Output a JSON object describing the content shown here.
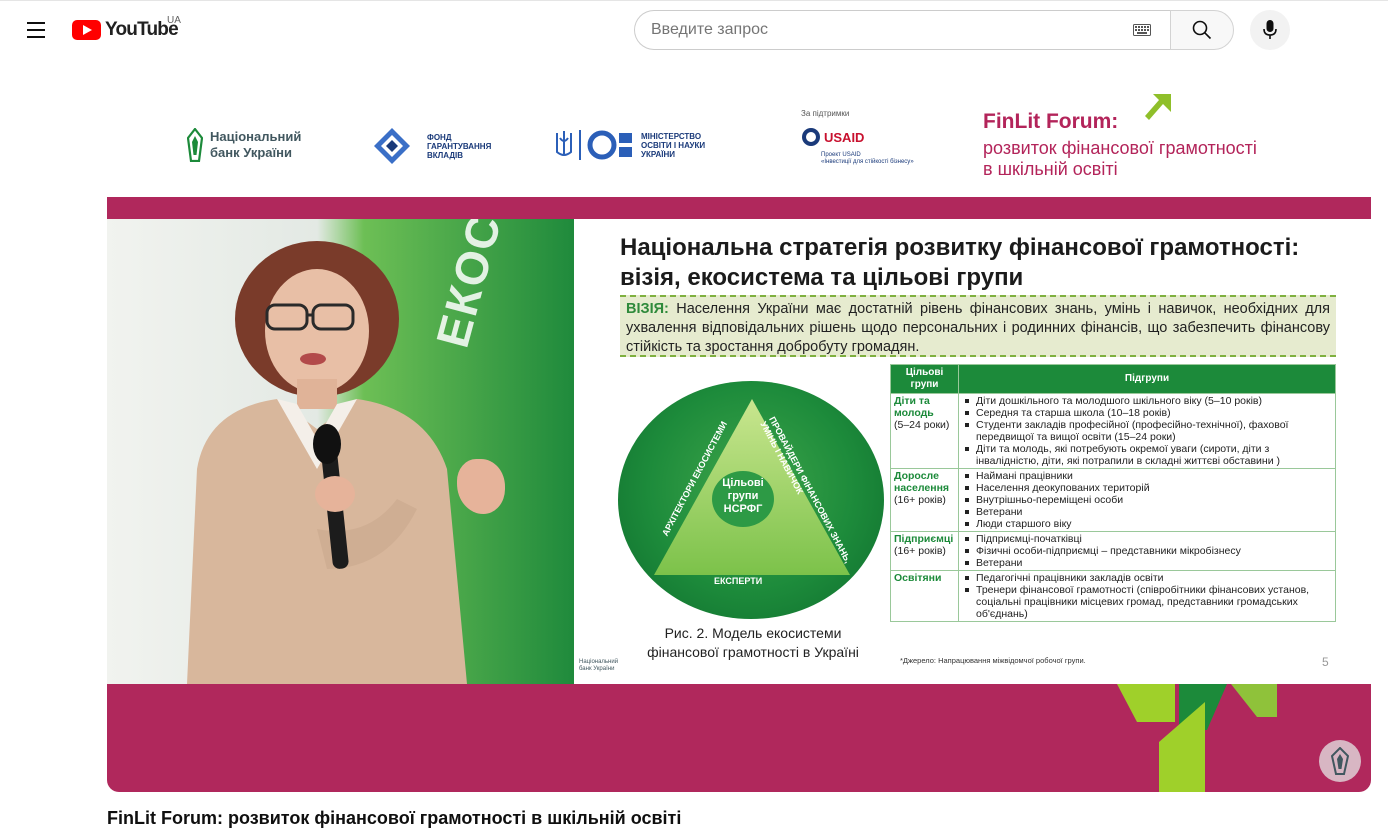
{
  "masthead": {
    "logo_text": "YouTube",
    "country_code": "UA",
    "search_placeholder": "Введите запрос"
  },
  "video": {
    "title": "FinLit Forum: розвиток фінансової грамотності в шкільній освіті"
  },
  "banner": {
    "nbu": "Національний\nбанк України",
    "fund": "ФОНД\nГАРАНТУВАННЯ\nВКЛАДІВ",
    "ministry": "МІНІСТЕРСТВО\nОСВІТИ І НАУКИ\nУКРАЇНИ",
    "support_label": "За підтримки",
    "usaid": "USAID",
    "usaid_project": "Проект USAID\n«Інвестиції для стійкості бізнесу»",
    "finlit_title": "FinLit Forum:",
    "finlit_subtitle": "розвиток фінансової грамотності\nв шкільній освіті"
  },
  "backdrop_text": "ЕКОСИСТЕМ",
  "slide": {
    "title": "Національна стратегія розвитку фінансової грамотності: візія, екосистема та цільові групи",
    "vision_label": "ВІЗІЯ:",
    "vision_text": "Населення України має достатній рівень фінансових знань, умінь і навичок, необхідних для ухвалення відповідальних рішень щодо персональних і родинних фінансів, що забезпечить фінансову стійкість та зростання добробуту громадян.",
    "diagram": {
      "center": "Цільові\nгрупи\nНСРФГ",
      "left": "АРХІТЕКТОРИ  ЕКОСИСТЕМИ",
      "right": "ПРОВАЙДЕРИ ФІНАНСОВИХ ЗНАНЬ,\nУМІНЬ І НАВИЧОК",
      "bottom": "ЕКСПЕРТИ"
    },
    "caption": "Рис. 2. Модель екосистеми\nфінансової грамотності в Україні",
    "logo": "Національний\nбанк України",
    "table": {
      "headers": [
        "Цільові групи",
        "Підгрупи"
      ],
      "rows": [
        {
          "group": "Діти та молодь",
          "age": "(5–24 роки)",
          "items": [
            "Діти дошкільного та молодшого шкільного віку (5–10 років)",
            "Середня та старша школа (10–18 років)",
            "Студенти закладів професійної (професійно-технічної), фахової передвищої та вищої освіти (15–24 роки)",
            "Діти та молодь, які потребують окремої уваги (сироти, діти з інвалідністю, діти, які потрапили в складні життєві обставини )"
          ]
        },
        {
          "group": "Доросле населення",
          "age": "(16+ років)",
          "items": [
            "Наймані працівники",
            "Населення деокупованих територій",
            "Внутрішньо-переміщені особи",
            "Ветерани",
            "Люди старшого віку"
          ]
        },
        {
          "group": "Підприємці",
          "age": "(16+ років)",
          "items": [
            "Підприємці-початківці",
            "Фізичні особи-підприємці – представники мікробізнесу",
            "Ветерани"
          ]
        },
        {
          "group": "Освітяни",
          "age": "",
          "items": [
            "Педагогічні працівники закладів освіти",
            "Тренери фінансової грамотності (співробітники фінансових установ, соціальні працівники місцевих громад, представники громадських об'єднань)"
          ]
        }
      ]
    },
    "source": "*Джерело: Напрацювання міжвідомчої робочої групи.",
    "page_number": "5"
  },
  "colors": {
    "brand_red": "#ff0000",
    "event_magenta": "#b0285c",
    "nbu_green": "#1c8a3a"
  }
}
